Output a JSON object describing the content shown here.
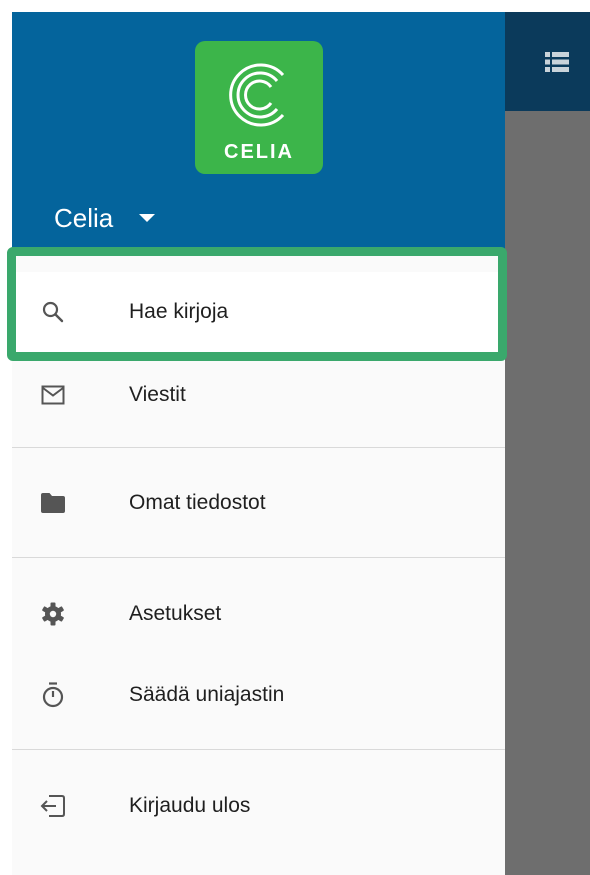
{
  "drawer": {
    "logo_text": "CELIA",
    "account_name": "Celia",
    "items": [
      {
        "label": "Hae kirjoja",
        "icon": "search-icon"
      },
      {
        "label": "Viestit",
        "icon": "mail-icon"
      },
      {
        "label": "Omat tiedostot",
        "icon": "folder-icon"
      },
      {
        "label": "Asetukset",
        "icon": "gear-icon"
      },
      {
        "label": "Säädä uniajastin",
        "icon": "timer-icon"
      },
      {
        "label": "Kirjaudu ulos",
        "icon": "logout-icon"
      }
    ]
  },
  "colors": {
    "header": "#04649c",
    "logo": "#3cb54a",
    "highlight": "#3aa86c",
    "app_topbar": "#0b3a5b",
    "scrim": "#6e6e6e"
  },
  "background_app": {
    "toolbar_icon": "list-icon"
  }
}
